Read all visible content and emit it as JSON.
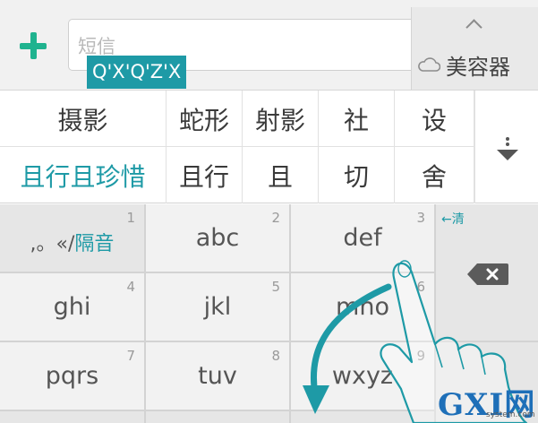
{
  "compose": {
    "placeholder": "短信",
    "pinyin_composing": "Q'X'Q'Z'X",
    "side_panel_label": "美容器"
  },
  "candidates": {
    "row1": [
      "摄影",
      "蛇形",
      "射影",
      "社",
      "设"
    ],
    "row2": [
      "且行且珍惜",
      "且行",
      "且",
      "切",
      "舍"
    ]
  },
  "keyboard": {
    "keys": [
      {
        "num": "1",
        "label_prefix": ",。«/",
        "label_accent": "隔音"
      },
      {
        "num": "2",
        "label": "abc"
      },
      {
        "num": "3",
        "label": "def"
      },
      {
        "num": "4",
        "label": "ghi"
      },
      {
        "num": "5",
        "label": "jkl"
      },
      {
        "num": "6",
        "label": "mno"
      },
      {
        "num": "7",
        "label": "pqrs"
      },
      {
        "num": "8",
        "label": "tuv"
      },
      {
        "num": "9",
        "label": "wxyz"
      }
    ],
    "clear_hint": "←清"
  },
  "watermark": {
    "logo": "GXI网",
    "site": "system.com"
  },
  "colors": {
    "accent": "#1e9aa6",
    "plus": "#1fb38f",
    "hand_outline": "#1e9aa6"
  }
}
